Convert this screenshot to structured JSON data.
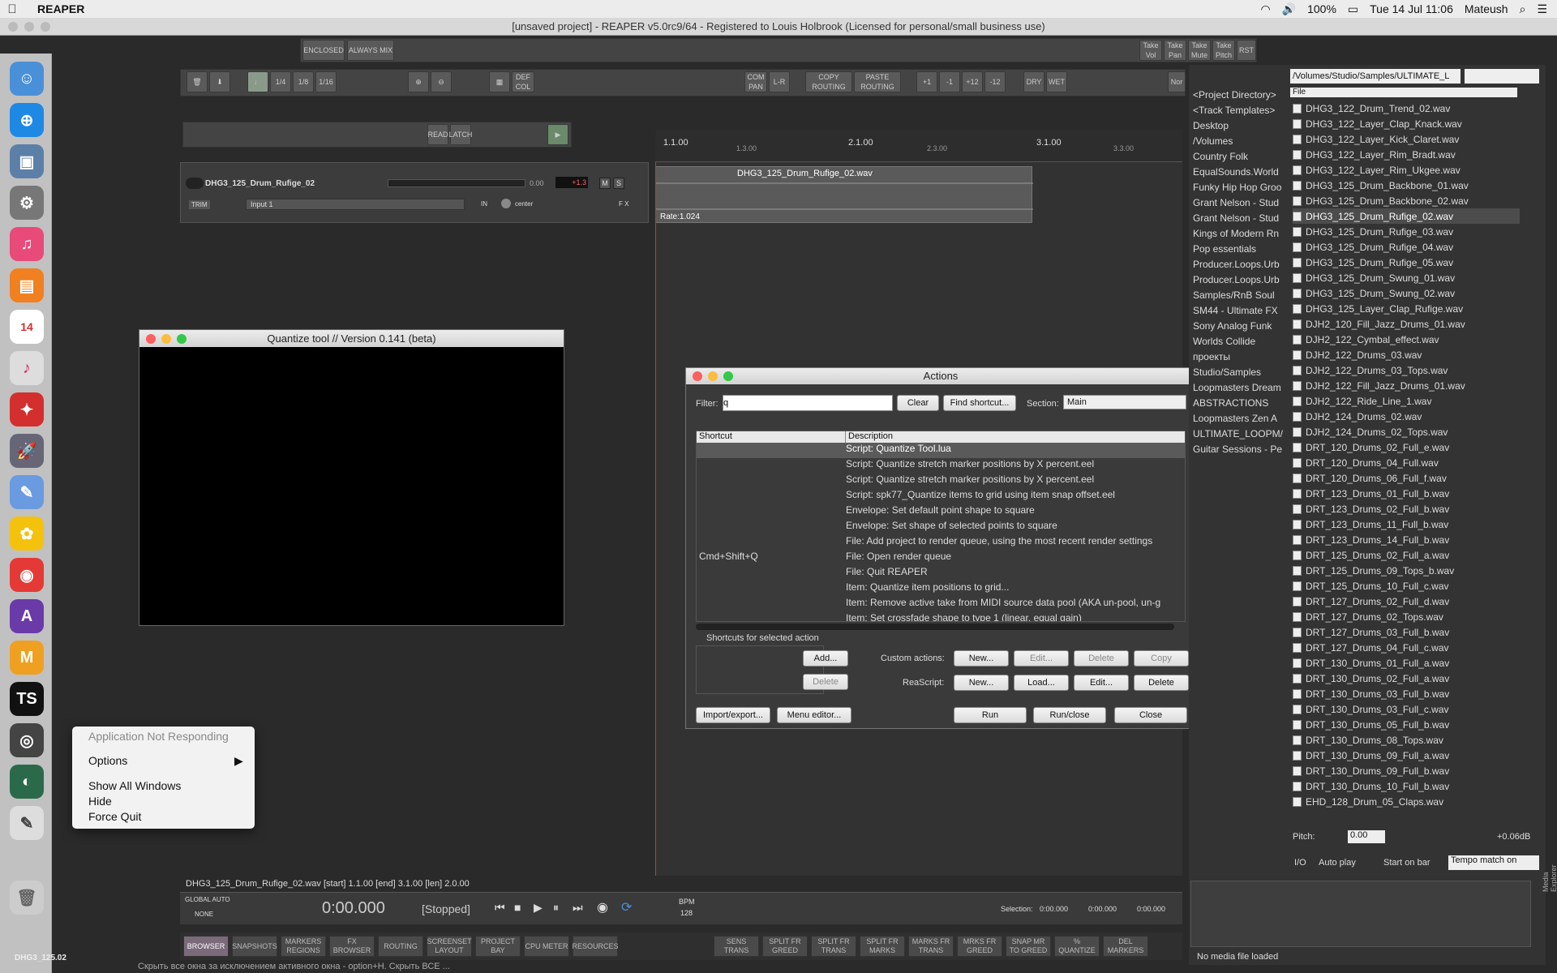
{
  "menubar": {
    "app_name": "REAPER",
    "battery": "100%",
    "datetime": "Tue 14 Jul  11:06",
    "user": "Mateush"
  },
  "window": {
    "title": "[unsaved project] - REAPER v5.0rc9/64 - Registered to Louis Holbrook (Licensed for personal/small business use)"
  },
  "toolbar": {
    "row1": [
      "ENCLOSED",
      "ALWAYS MIX",
      "Take Vol",
      "Take Pan",
      "Take Mute",
      "Take Pitch",
      "RST"
    ],
    "row2": [
      "1/4",
      "1/8",
      "1/16",
      "DEF COL",
      "COM PAN",
      "L-R",
      "COPY ROUTING",
      "PASTE ROUTING",
      "+1",
      "-1",
      "+12",
      "-12",
      "DRY",
      "WET",
      "Nor"
    ],
    "row3": [
      "READ",
      "LATCH"
    ]
  },
  "track": {
    "name": "DHG3_125_Drum_Rufige_02",
    "volume": "0.00",
    "meter": "+1.3",
    "input": "Input 1",
    "pan": "center",
    "trim": "TRIM",
    "in": "IN",
    "fx": "F X"
  },
  "ruler": {
    "marks": [
      "1.1.00",
      "1.3.00",
      "2.1.00",
      "2.3.00",
      "3.1.00",
      "3.3.00"
    ]
  },
  "item": {
    "name": "DHG3_125_Drum_Rufige_02.wav",
    "rate": "Rate:1.024"
  },
  "quantize_window": {
    "title": "Quantize tool // Version 0.141 (beta)"
  },
  "actions_window": {
    "title": "Actions",
    "filter_label": "Filter:",
    "filter_value": "q",
    "clear": "Clear",
    "find_shortcut": "Find shortcut...",
    "section_label": "Section:",
    "section_value": "Main",
    "col_shortcut": "Shortcut",
    "col_description": "Description",
    "rows": [
      {
        "shortcut": "",
        "desc": "Script: Quantize Tool.lua"
      },
      {
        "shortcut": "",
        "desc": "Script: Quantize stretch marker positions by X percent.eel"
      },
      {
        "shortcut": "",
        "desc": "Script: Quantize stretch marker positions by X percent.eel"
      },
      {
        "shortcut": "",
        "desc": "Script: spk77_Quantize items to grid using item snap offset.eel"
      },
      {
        "shortcut": "",
        "desc": "Envelope: Set default point shape to square"
      },
      {
        "shortcut": "",
        "desc": "Envelope: Set shape of selected points to square"
      },
      {
        "shortcut": "",
        "desc": "File: Add project to render queue, using the most recent render settings"
      },
      {
        "shortcut": "Cmd+Shift+Q",
        "desc": "File: Open render queue"
      },
      {
        "shortcut": "",
        "desc": "File: Quit REAPER"
      },
      {
        "shortcut": "",
        "desc": "Item: Quantize item positions to grid..."
      },
      {
        "shortcut": "",
        "desc": "Item: Remove active take from MIDI source data pool (AKA un-pool, un-g"
      },
      {
        "shortcut": "",
        "desc": "Item: Set crossfade shape to type 1 (linear, equal gain)"
      }
    ],
    "shortcuts_label": "Shortcuts for selected action",
    "add": "Add...",
    "delete": "Delete",
    "custom_actions_label": "Custom actions:",
    "reascript_label": "ReaScript:",
    "new": "New...",
    "edit": "Edit...",
    "copy": "Copy",
    "load": "Load...",
    "import_export": "Import/export...",
    "menu_editor": "Menu editor...",
    "run": "Run",
    "run_close": "Run/close",
    "close": "Close"
  },
  "media_explorer": {
    "path": "/Volumes/Studio/Samples/ULTIMATE_L",
    "file_header": "File",
    "dirs": [
      "<Project Directory>",
      "<Track Templates>",
      "Desktop",
      "/Volumes",
      "Country Folk",
      "EqualSounds.World",
      "Funky Hip Hop Groo",
      "Grant Nelson - Stud",
      "Grant Nelson - Stud",
      "Kings of Modern Rn",
      "Pop essentials",
      "Producer.Loops.Urb",
      "Producer.Loops.Urb",
      "Samples/RnB Soul",
      "SM44 - Ultimate FX",
      "Sony Analog Funk",
      "Worlds Collide",
      "проекты",
      "Studio/Samples",
      "Loopmasters Dream",
      "ABSTRACTIONS",
      "Loopmasters Zen A",
      "ULTIMATE_LOOPM/",
      "Guitar Sessions - Pe"
    ],
    "files": [
      "DHG3_122_Drum_Trend_02.wav",
      "DHG3_122_Layer_Clap_Knack.wav",
      "DHG3_122_Layer_Kick_Claret.wav",
      "DHG3_122_Layer_Rim_Bradt.wav",
      "DHG3_122_Layer_Rim_Ukgee.wav",
      "DHG3_125_Drum_Backbone_01.wav",
      "DHG3_125_Drum_Backbone_02.wav",
      "DHG3_125_Drum_Rufige_02.wav",
      "DHG3_125_Drum_Rufige_03.wav",
      "DHG3_125_Drum_Rufige_04.wav",
      "DHG3_125_Drum_Rufige_05.wav",
      "DHG3_125_Drum_Swung_01.wav",
      "DHG3_125_Drum_Swung_02.wav",
      "DHG3_125_Layer_Clap_Rufige.wav",
      "DJH2_120_Fill_Jazz_Drums_01.wav",
      "DJH2_122_Cymbal_effect.wav",
      "DJH2_122_Drums_03.wav",
      "DJH2_122_Drums_03_Tops.wav",
      "DJH2_122_Fill_Jazz_Drums_01.wav",
      "DJH2_122_Ride_Line_1.wav",
      "DJH2_124_Drums_02.wav",
      "DJH2_124_Drums_02_Tops.wav",
      "DRT_120_Drums_02_Full_e.wav",
      "DRT_120_Drums_04_Full.wav",
      "DRT_120_Drums_06_Full_f.wav",
      "DRT_123_Drums_01_Full_b.wav",
      "DRT_123_Drums_02_Full_b.wav",
      "DRT_123_Drums_11_Full_b.wav",
      "DRT_123_Drums_14_Full_b.wav",
      "DRT_125_Drums_02_Full_a.wav",
      "DRT_125_Drums_09_Tops_b.wav",
      "DRT_125_Drums_10_Full_c.wav",
      "DRT_127_Drums_02_Full_d.wav",
      "DRT_127_Drums_02_Tops.wav",
      "DRT_127_Drums_03_Full_b.wav",
      "DRT_127_Drums_04_Full_c.wav",
      "DRT_130_Drums_01_Full_a.wav",
      "DRT_130_Drums_02_Full_a.wav",
      "DRT_130_Drums_03_Full_b.wav",
      "DRT_130_Drums_03_Full_c.wav",
      "DRT_130_Drums_05_Full_b.wav",
      "DRT_130_Drums_08_Tops.wav",
      "DRT_130_Drums_09_Full_a.wav",
      "DRT_130_Drums_09_Full_b.wav",
      "DRT_130_Drums_10_Full_b.wav",
      "EHD_128_Drum_05_Claps.wav"
    ],
    "pitch_label": "Pitch:",
    "pitch_value": "0.00",
    "gain": "+0.06dB",
    "auto_play": "Auto play",
    "start_on_bar": "Start on bar",
    "tempo_match": "Tempo match on",
    "io": "I/O",
    "status": "No media file loaded",
    "side_tab_1": "Mixer Master",
    "side_tab_2": "Media Explorer"
  },
  "status_line": "DHG3_125_Drum_Rufige_02.wav [start] 1.1.00 [end] 3.1.00 [len] 2.0.00",
  "transport": {
    "global_auto": "GLOBAL AUTO",
    "none": "NONE",
    "time": "0:00.000",
    "state": "[Stopped]",
    "bpm_label": "BPM",
    "bpm": "128",
    "selection_label": "Selection:",
    "sel_start": "0:00.000",
    "sel_end": "0:00.000",
    "sel_len": "0:00.000"
  },
  "bottom_buttons": [
    "BROWSER",
    "SNAPSHOTS",
    "MARKERS REGIONS",
    "FX BROWSER",
    "ROUTING",
    "SCREENSET LAYOUT",
    "PROJECT BAY",
    "CPU METER",
    "RESOURCES",
    "SENS TRANS",
    "SPLIT FR GREED",
    "SPLIT FR TRANS",
    "SPLIT FR MARKS",
    "MARKS FR TRANS",
    "MRKS FR GREED",
    "SNAP MR TO GREED",
    "% QUANTIZE",
    "DEL MARKERS"
  ],
  "context_menu": {
    "not_responding": "Application Not Responding",
    "options": "Options",
    "show_all": "Show All Windows",
    "hide": "Hide",
    "force_quit": "Force Quit"
  },
  "dock_label": "DHG3_125.02",
  "bottom_text": "Скрыть все окна за исключением активного окна - option+H. Скрыть ВСЕ ..."
}
